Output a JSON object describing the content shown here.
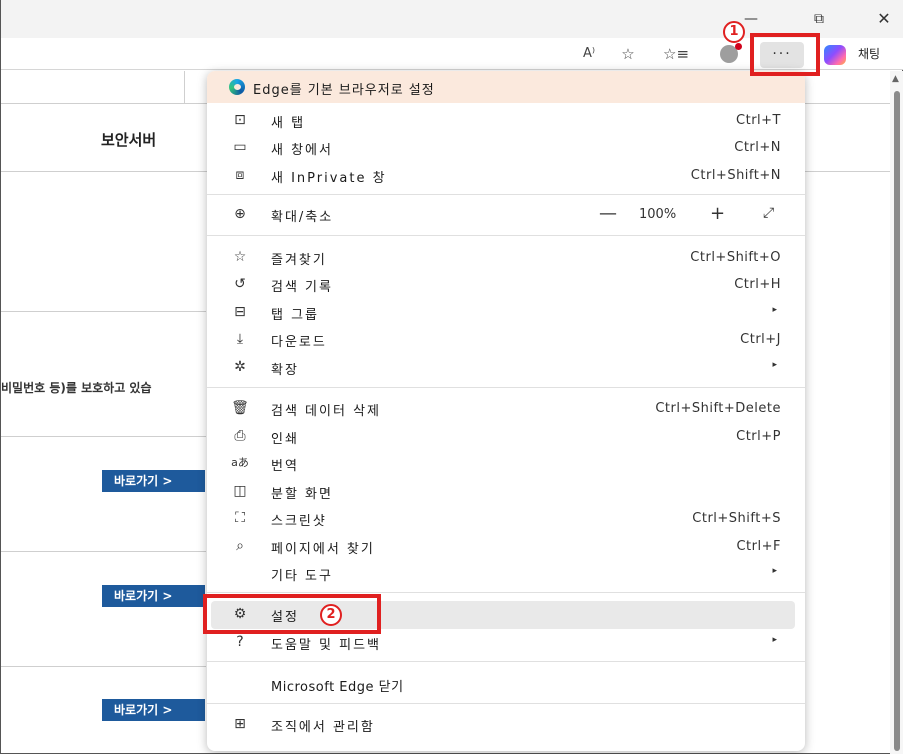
{
  "window": {
    "minimize_glyph": "—",
    "restore_glyph": "⧉",
    "close_glyph": "✕"
  },
  "toolbar": {
    "read_aloud_glyph": "A⁾",
    "favorite_glyph": "☆",
    "favorites_glyph": "☆≡",
    "more_label": "···",
    "chat_label": "채팅"
  },
  "annotations": {
    "step1": "1",
    "step2": "2"
  },
  "page": {
    "title": "보안서버",
    "text": "비밀번호 등)를 보호하고 있습",
    "go_buttons": [
      "바로가기 >",
      "바로가기 >",
      "바로가기 >"
    ]
  },
  "menu": {
    "banner": "Edge를 기본 브라우저로 설정",
    "items": [
      {
        "icon": "new-tab-icon",
        "glyph": "⊡",
        "label": "새 탭",
        "shortcut": "Ctrl+T"
      },
      {
        "icon": "new-window-icon",
        "glyph": "▭",
        "label": "새 창에서",
        "shortcut": "Ctrl+N"
      },
      {
        "icon": "inprivate-icon",
        "glyph": "⧈",
        "label": "새 InPrivate 창",
        "shortcut": "Ctrl+Shift+N"
      },
      {
        "icon": "zoom-icon",
        "glyph": "⊕",
        "label": "확대/축소"
      },
      {
        "icon": "favorites-icon",
        "glyph": "☆",
        "label": "즐겨찾기",
        "shortcut": "Ctrl+Shift+O"
      },
      {
        "icon": "history-icon",
        "glyph": "↺",
        "label": "검색 기록",
        "shortcut": "Ctrl+H"
      },
      {
        "icon": "tab-groups-icon",
        "glyph": "⊟",
        "label": "탭 그룹"
      },
      {
        "icon": "download-icon",
        "glyph": "⤓",
        "label": "다운로드",
        "shortcut": "Ctrl+J"
      },
      {
        "icon": "extensions-icon",
        "glyph": "✲",
        "label": "확장"
      },
      {
        "icon": "delete-data-icon",
        "glyph": "🗑",
        "label": "검색 데이터 삭제",
        "shortcut": "Ctrl+Shift+Delete"
      },
      {
        "icon": "print-icon",
        "glyph": "⎙",
        "label": "인쇄",
        "shortcut": "Ctrl+P"
      },
      {
        "icon": "translate-icon",
        "glyph": "aあ",
        "label": "번역"
      },
      {
        "icon": "split-screen-icon",
        "glyph": "◫",
        "label": "분할 화면"
      },
      {
        "icon": "screenshot-icon",
        "glyph": "⛶",
        "label": "스크린샷",
        "shortcut": "Ctrl+Shift+S"
      },
      {
        "icon": "find-icon",
        "glyph": "⌕",
        "label": "페이지에서 찾기",
        "shortcut": "Ctrl+F"
      },
      {
        "label": "기타 도구"
      },
      {
        "icon": "settings-icon",
        "glyph": "⚙",
        "label": "설정"
      },
      {
        "icon": "help-icon",
        "glyph": "?",
        "label": "도움말 및 피드백"
      },
      {
        "label": "Microsoft Edge 닫기"
      },
      {
        "icon": "organization-icon",
        "glyph": "⊞",
        "label": "조직에서 관리함"
      }
    ],
    "zoom": {
      "minus": "—",
      "value": "100%",
      "plus": "+",
      "fullscreen": "⤢"
    },
    "submenu_arrow": "▸"
  }
}
